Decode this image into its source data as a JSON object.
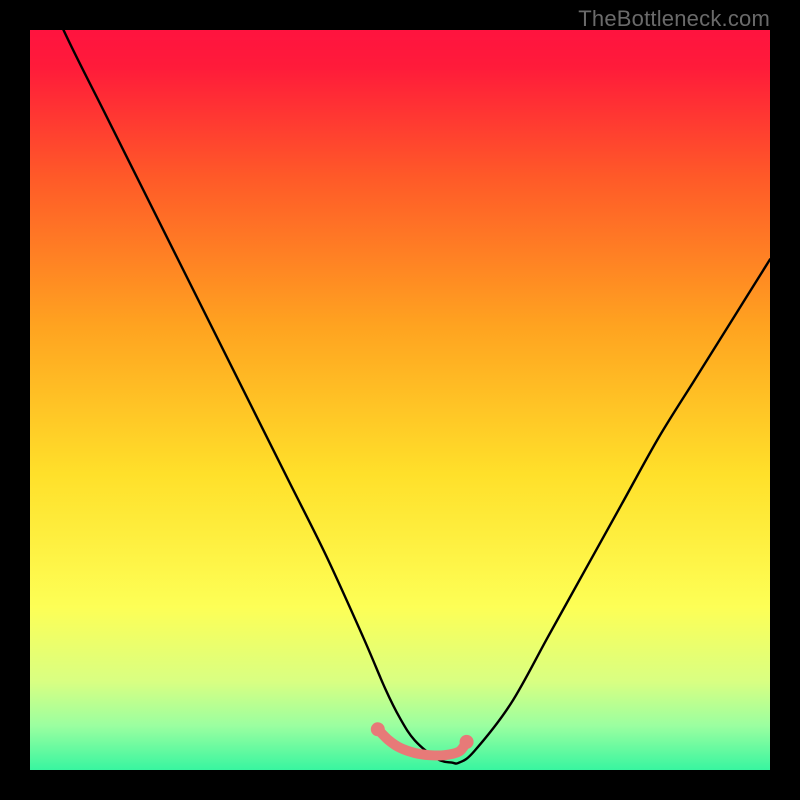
{
  "watermark": {
    "text": "TheBottleneck.com"
  },
  "colors": {
    "background": "#000000",
    "gradient_stops": [
      {
        "pos": 0.0,
        "color": "#ff133f"
      },
      {
        "pos": 0.05,
        "color": "#ff1b3a"
      },
      {
        "pos": 0.2,
        "color": "#ff5a28"
      },
      {
        "pos": 0.4,
        "color": "#ffa320"
      },
      {
        "pos": 0.6,
        "color": "#ffe02a"
      },
      {
        "pos": 0.78,
        "color": "#fdff56"
      },
      {
        "pos": 0.88,
        "color": "#d9ff82"
      },
      {
        "pos": 0.94,
        "color": "#9bffa0"
      },
      {
        "pos": 1.0,
        "color": "#38f5a0"
      }
    ],
    "curve": "#000000",
    "accent": "#e77a78",
    "watermark": "#6a6a6a"
  },
  "chart_data": {
    "type": "line",
    "title": "",
    "xlabel": "",
    "ylabel": "",
    "xlim": [
      0,
      100
    ],
    "ylim": [
      0,
      100
    ],
    "grid": false,
    "legend_position": "none",
    "series": [
      {
        "name": "bottleneck-curve",
        "x": [
          0,
          5,
          10,
          15,
          20,
          25,
          30,
          35,
          40,
          45,
          48,
          50,
          52,
          55,
          57,
          58,
          60,
          65,
          70,
          75,
          80,
          85,
          90,
          95,
          100
        ],
        "values": [
          110,
          99,
          89,
          79,
          69,
          59,
          49,
          39,
          29,
          18,
          11,
          7,
          4,
          1.5,
          1,
          1,
          2.5,
          9,
          18,
          27,
          36,
          45,
          53,
          61,
          69
        ]
      }
    ],
    "accent_segment": {
      "name": "optimal-range-marker",
      "x": [
        47,
        48.5,
        50,
        52,
        54,
        56,
        58,
        59
      ],
      "values": [
        5.5,
        4.0,
        3.0,
        2.3,
        2.0,
        2.0,
        2.5,
        3.8
      ],
      "endpoint_markers": [
        {
          "x": 47,
          "y": 5.5
        },
        {
          "x": 59,
          "y": 3.8
        }
      ]
    }
  }
}
